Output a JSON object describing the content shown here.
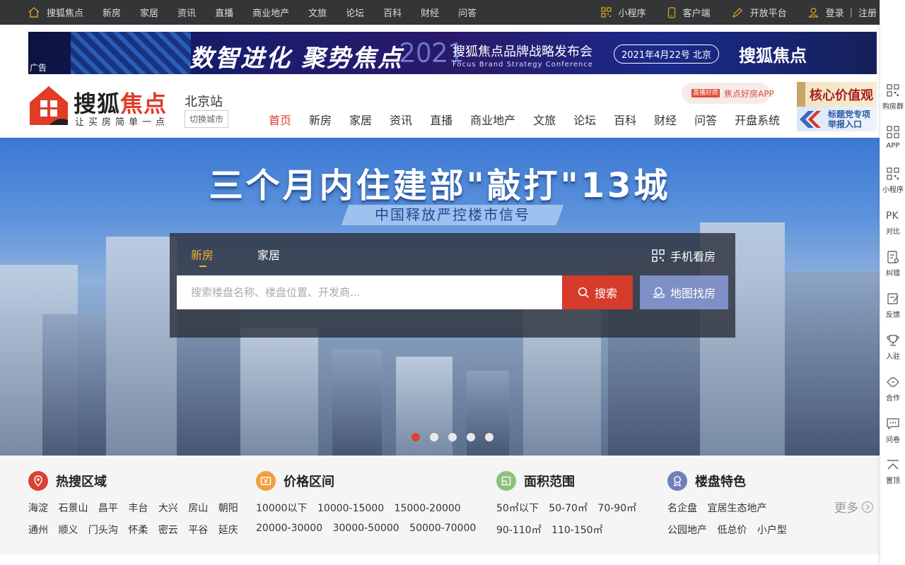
{
  "topbar": {
    "home": "搜狐焦点",
    "links": [
      "新房",
      "家居",
      "资讯",
      "直播",
      "商业地产",
      "文旅",
      "论坛",
      "百科",
      "财经",
      "问答"
    ],
    "miniprogram": "小程序",
    "client": "客户端",
    "openplatform": "开放平台",
    "login": "登录",
    "separator": "|",
    "register": "注册"
  },
  "ad": {
    "slogan": "数智进化 聚势焦点",
    "year": "2021",
    "event_title": "搜狐焦点品牌战略发布会",
    "event_subtitle": "Focus Brand Strategy Conference",
    "date": "2021年4月22号 北京",
    "brand": "搜狐焦点",
    "label": "广告"
  },
  "header": {
    "logo_name_a": "搜狐",
    "logo_name_b": "焦点",
    "logo_tagline": "让买房简单一点",
    "city": "北京站",
    "switch_city": "切换城市",
    "app_badge_icon": "直播好房",
    "app_badge": "焦点好房APP",
    "nav": [
      "首页",
      "新房",
      "家居",
      "资讯",
      "直播",
      "商业地产",
      "文旅",
      "论坛",
      "百科",
      "财经",
      "问答",
      "开盘系统"
    ],
    "promo1": "核心价值观",
    "promo2_line1": "标题党专项",
    "promo2_line2": "举报入口"
  },
  "hero": {
    "headline": "三个月内住建部\"敲打\"13城",
    "subline": "中国释放严控楼市信号",
    "slides": 5,
    "active_slide": 1
  },
  "search": {
    "tabs": [
      "新房",
      "家居"
    ],
    "active_tab": "新房",
    "mobile": "手机看房",
    "placeholder": "搜索楼盘名称、楼盘位置、开发商...",
    "search_button": "搜索",
    "map_button": "地图找房"
  },
  "quick": {
    "hot_area": {
      "title": "热搜区域",
      "row1": [
        "海淀",
        "石景山",
        "昌平",
        "丰台",
        "大兴",
        "房山",
        "朝阳"
      ],
      "row2": [
        "通州",
        "顺义",
        "门头沟",
        "怀柔",
        "密云",
        "平谷",
        "延庆"
      ]
    },
    "price": {
      "title": "价格区间",
      "row1": [
        "10000以下",
        "10000-15000",
        "15000-20000"
      ],
      "row2": [
        "20000-30000",
        "30000-50000",
        "50000-70000"
      ]
    },
    "area": {
      "title": "面积范围",
      "row1": [
        "50㎡以下",
        "50-70㎡",
        "70-90㎡"
      ],
      "row2": [
        "90-110㎡",
        "110-150㎡"
      ]
    },
    "feature": {
      "title": "楼盘特色",
      "row1": [
        "名企盘",
        "宜居生态地产"
      ],
      "row2": [
        "公园地产",
        "低总价",
        "小户型"
      ]
    },
    "more": "更多"
  },
  "sidebar": [
    "购房群",
    "APP",
    "小程序",
    "对比",
    "纠错",
    "反馈",
    "入驻",
    "合作",
    "问卷",
    "置顶"
  ],
  "colors": {
    "accent": "#e03c28",
    "search_red": "#d63b2b",
    "map_blue": "#7f90c8",
    "tab_active": "#f5b031"
  }
}
